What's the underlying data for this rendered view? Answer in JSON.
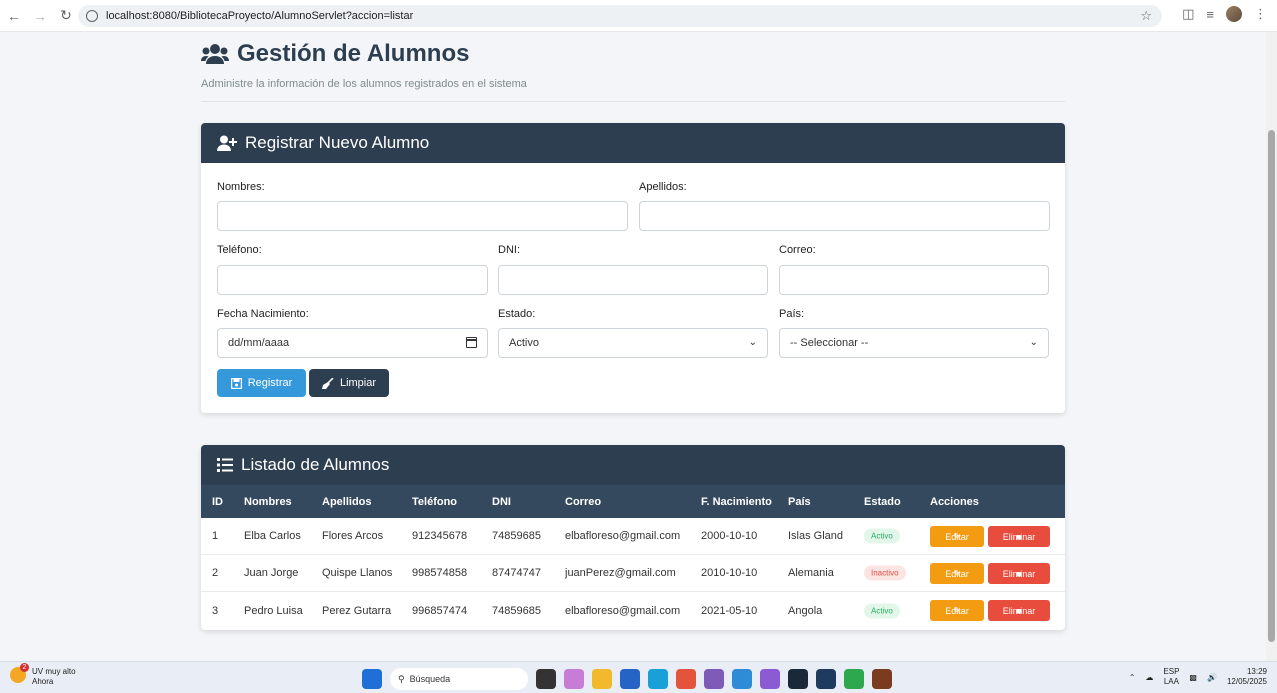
{
  "browser": {
    "url": "localhost:8080/BibliotecaProyecto/AlumnoServlet?accion=listar"
  },
  "page": {
    "title": "Gestión de Alumnos",
    "subtitle": "Administre la información de los alumnos registrados en el sistema"
  },
  "form": {
    "title": "Registrar Nuevo Alumno",
    "labels": {
      "nombres": "Nombres:",
      "apellidos": "Apellidos:",
      "telefono": "Teléfono:",
      "dni": "DNI:",
      "correo": "Correo:",
      "fecha": "Fecha Nacimiento:",
      "estado": "Estado:",
      "pais": "País:"
    },
    "values": {
      "fecha_placeholder": "dd/mm/aaaa",
      "estado": "Activo",
      "pais": "-- Seleccionar --"
    },
    "buttons": {
      "register": "Registrar",
      "clear": "Limpiar"
    }
  },
  "list": {
    "title": "Listado de Alumnos",
    "columns": [
      "ID",
      "Nombres",
      "Apellidos",
      "Teléfono",
      "DNI",
      "Correo",
      "F. Nacimiento",
      "País",
      "Estado",
      "Acciones"
    ],
    "rows": [
      {
        "id": "1",
        "nombres": "Elba Carlos",
        "apellidos": "Flores Arcos",
        "telefono": "912345678",
        "dni": "74859685",
        "correo": "elbafloreso@gmail.com",
        "fecha": "2000-10-10",
        "pais": "Islas Gland",
        "estado": "Activo"
      },
      {
        "id": "2",
        "nombres": "Juan Jorge",
        "apellidos": "Quispe Llanos",
        "telefono": "998574858",
        "dni": "87474747",
        "correo": "juanPerez@gmail.com",
        "fecha": "2010-10-10",
        "pais": "Alemania",
        "estado": "Inactivo"
      },
      {
        "id": "3",
        "nombres": "Pedro Luisa",
        "apellidos": "Perez Gutarra",
        "telefono": "996857474",
        "dni": "74859685",
        "correo": "elbafloreso@gmail.com",
        "fecha": "2021-05-10",
        "pais": "Angola",
        "estado": "Activo"
      }
    ],
    "actions": {
      "edit": "Editar",
      "delete": "Eliminar"
    }
  },
  "taskbar": {
    "weather_title": "UV muy alto",
    "weather_sub": "Ahora",
    "search": "Búsqueda",
    "lang_top": "ESP",
    "lang_bottom": "LAA",
    "time": "13:29",
    "date": "12/05/2025",
    "badge_count": "55"
  },
  "colors": {
    "header_dark": "#2c3e50",
    "primary": "#3498db",
    "warning": "#f39c12",
    "danger": "#e74c3c",
    "success": "#27ae60"
  }
}
